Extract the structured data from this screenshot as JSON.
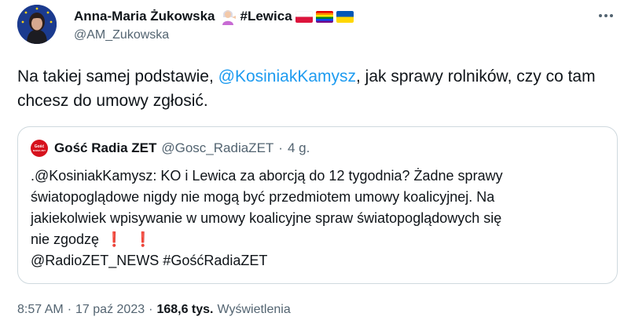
{
  "author": {
    "name": "Anna-Maria Żukowska",
    "hashtag": "#Lewica",
    "handle": "@AM_Zukowska"
  },
  "tweet": {
    "text_before": "Na takiej samej podstawie, ",
    "mention": "@KosiniakKamysz",
    "text_after": ", jak sprawy rolników, czy co tam chcesz do umowy zgłosić."
  },
  "quote": {
    "name": "Gość Radia ZET",
    "handle": "@Gosc_RadiaZET",
    "dot": "·",
    "time": "4 g.",
    "logo_top": "Gość",
    "logo_bottom": "RADIA ZET",
    "line1": ".@KosiniakKamysz: KO i Lewica za aborcją do 12 tygodnia? Żadne sprawy",
    "line2": "światopoglądowe nigdy nie mogą być przedmiotem umowy koalicyjnej. Na",
    "line3": "jakiekolwiek wpisywanie w umowy koalicyjne spraw światopoglądowych się",
    "line4": "nie zgodzę",
    "bang": "❗",
    "line5": "@RadioZET_NEWS #GośćRadiaZET"
  },
  "meta": {
    "time": "8:57 AM",
    "dot": "·",
    "date": "17 paź 2023",
    "views_count": "168,6 tys.",
    "views_label": "Wyświetlenia"
  },
  "colors": {
    "link": "#1d9bf0",
    "secondary_text": "#536471",
    "border": "#cfd9de"
  },
  "icons": {
    "more": "more-icon",
    "emoji": "woman-tipping-hand-emoji",
    "flags": [
      "poland-flag",
      "rainbow-flag",
      "ukraine-flag"
    ]
  }
}
